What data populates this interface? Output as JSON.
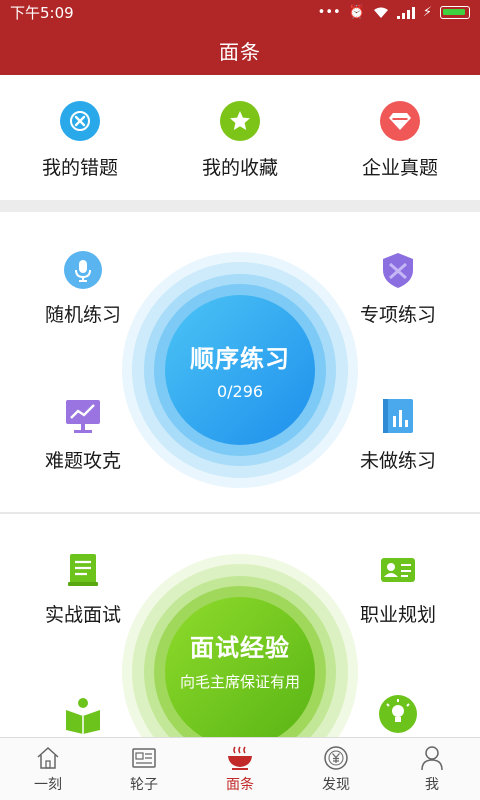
{
  "status": {
    "time": "下午5:09",
    "dots": "•••"
  },
  "header": {
    "title": "面条"
  },
  "quick": [
    {
      "label": "我的错题",
      "icon": "close-circle-icon",
      "color": "#29a8ea"
    },
    {
      "label": "我的收藏",
      "icon": "star-icon",
      "color": "#7cc417"
    },
    {
      "label": "企业真题",
      "icon": "diamond-icon",
      "color": "#f05858"
    }
  ],
  "practice": {
    "random_label": "随机练习",
    "special_label": "专项练习",
    "hard_label": "难题攻克",
    "undone_label": "未做练习",
    "main_title": "顺序练习",
    "main_progress": "0/296",
    "accent": "#2196f3"
  },
  "interview": {
    "combat_label": "实战面试",
    "career_label": "职业规划",
    "main_title": "面试经验",
    "main_sub": "向毛主席保证有用",
    "accent": "#6cc31b"
  },
  "nav": {
    "items": [
      {
        "label": "一刻",
        "icon": "home-icon"
      },
      {
        "label": "轮子",
        "icon": "news-icon"
      },
      {
        "label": "面条",
        "icon": "noodle-bowl-icon"
      },
      {
        "label": "发现",
        "icon": "yuan-coin-icon"
      },
      {
        "label": "我",
        "icon": "person-icon"
      }
    ],
    "active_index": 2,
    "active_color": "#c22a2a"
  }
}
